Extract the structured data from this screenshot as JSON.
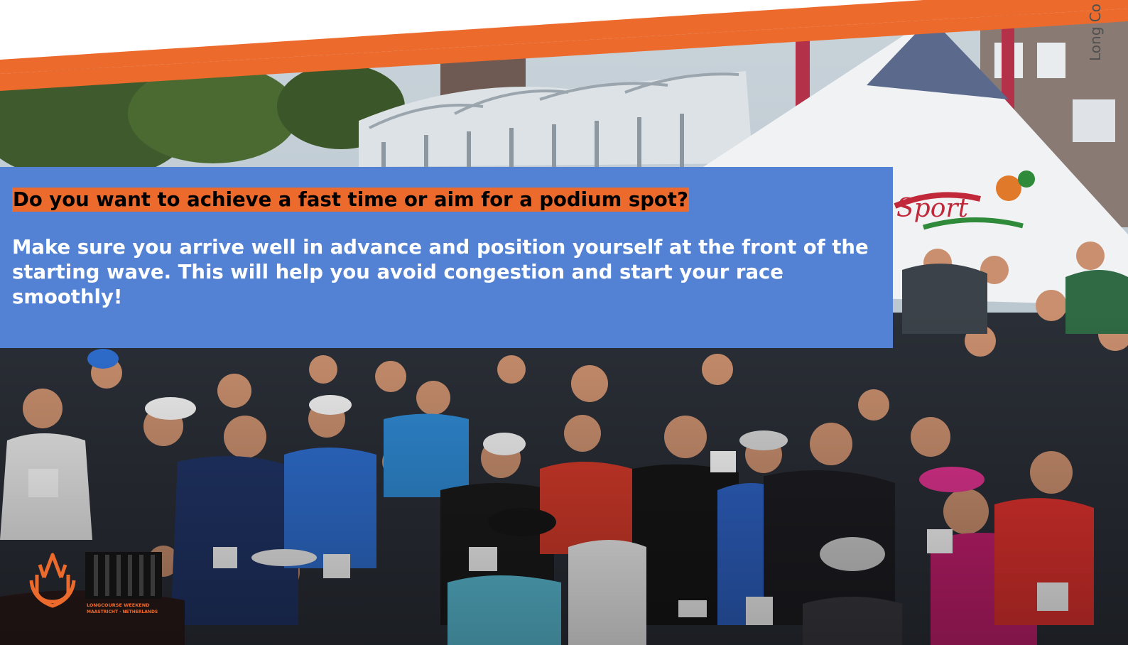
{
  "slide": {
    "question": "Do you want to achieve a fast time or aim for a podium spot?",
    "advice": "Make sure you arrive well in advance and position yourself at the front of the starting wave. This will help you avoid congestion and start your race smoothly!",
    "side_tag": "Long Co"
  },
  "photo": {
    "subject": "crowd of runners at a race start line",
    "tent_lettering": "Sport"
  },
  "logo": {
    "text_line1": "LONGCOURSE WEEKEND",
    "text_line2": "MAASTRICHT · NETHERLANDS"
  },
  "colors": {
    "accent_orange": "#ec6a2c",
    "panel_blue": "#5382d4",
    "question_text": "#000000",
    "body_text": "#ffffff"
  }
}
